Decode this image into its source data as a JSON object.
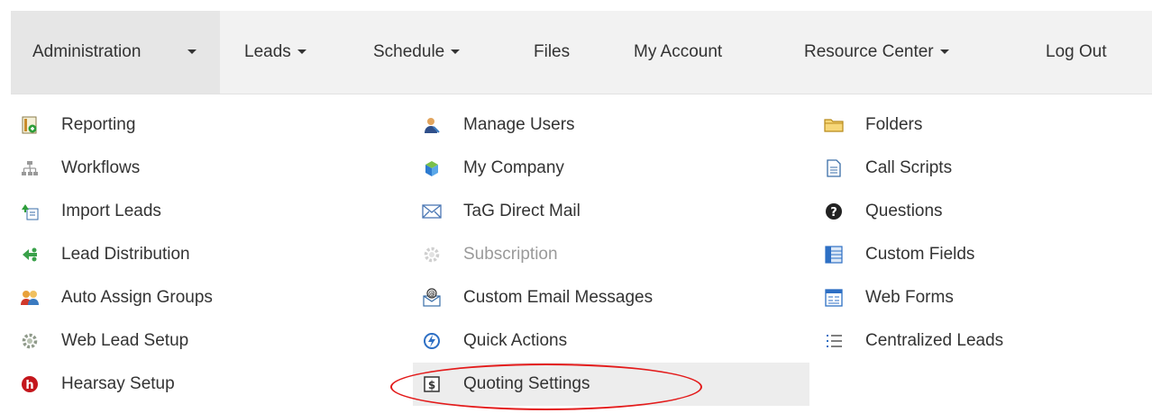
{
  "nav": {
    "administration": "Administration",
    "leads": "Leads",
    "schedule": "Schedule",
    "files": "Files",
    "my_account": "My Account",
    "resource_center": "Resource Center",
    "log_out": "Log Out"
  },
  "menu": {
    "col1": [
      {
        "label": "Reporting",
        "icon": "report-icon"
      },
      {
        "label": "Workflows",
        "icon": "sitemap-icon"
      },
      {
        "label": "Import Leads",
        "icon": "import-icon"
      },
      {
        "label": "Lead Distribution",
        "icon": "distribution-icon"
      },
      {
        "label": "Auto Assign Groups",
        "icon": "group-icon"
      },
      {
        "label": "Web Lead Setup",
        "icon": "gear-icon"
      },
      {
        "label": "Hearsay Setup",
        "icon": "hearsay-icon"
      }
    ],
    "col2": [
      {
        "label": "Manage Users",
        "icon": "user-icon"
      },
      {
        "label": "My Company",
        "icon": "company-icon"
      },
      {
        "label": "TaG Direct Mail",
        "icon": "envelope-icon"
      },
      {
        "label": "Subscription",
        "icon": "gear-icon",
        "disabled": true
      },
      {
        "label": "Custom Email Messages",
        "icon": "email-at-icon"
      },
      {
        "label": "Quick Actions",
        "icon": "bolt-icon"
      },
      {
        "label": "Quoting Settings",
        "icon": "dollar-icon",
        "highlighted": true
      }
    ],
    "col3": [
      {
        "label": "Folders",
        "icon": "folder-icon"
      },
      {
        "label": "Call Scripts",
        "icon": "document-icon"
      },
      {
        "label": "Questions",
        "icon": "question-icon"
      },
      {
        "label": "Custom Fields",
        "icon": "fields-icon"
      },
      {
        "label": "Web Forms",
        "icon": "form-icon"
      },
      {
        "label": "Centralized Leads",
        "icon": "list-icon"
      }
    ]
  },
  "colors": {
    "navbar_bg": "#f2f2f2",
    "active_bg": "#e6e6e6",
    "hover_bg": "#ededed",
    "annotation_red": "#e31b1b",
    "disabled_text": "#9a9a9a"
  }
}
